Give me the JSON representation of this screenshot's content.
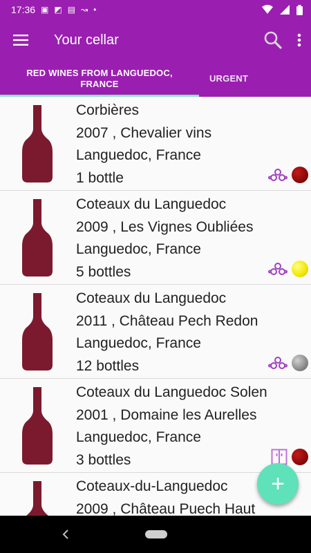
{
  "status_bar": {
    "time": "17:36"
  },
  "app_bar": {
    "title": "Your cellar",
    "menu_icon": "hamburger-icon",
    "search_icon": "search-icon",
    "more_icon": "more-vert-icon"
  },
  "tabs": [
    {
      "label_line1": "RED WINES FROM LANGUEDOC,",
      "label_line2": "FRANCE",
      "active": true
    },
    {
      "label_line1": "URGENT",
      "label_line2": "",
      "active": false
    }
  ],
  "colors": {
    "primary": "#9a1fb0",
    "accent": "#5fe1b9",
    "bottle": "#7b1a2e"
  },
  "wines": [
    {
      "name": "Corbières",
      "year_producer": "2007 , Chevalier vins",
      "region": "Languedoc, France",
      "count": "1  bottle",
      "storage_icon": "bottles-rack-icon",
      "status_color": "#8b0a0a"
    },
    {
      "name": "Coteaux du Languedoc",
      "year_producer": "2009 , Les Vignes Oubliées",
      "region": "Languedoc, France",
      "count": "5  bottles",
      "storage_icon": "bottles-rack-icon",
      "status_color": "#f2e600"
    },
    {
      "name": "Coteaux du Languedoc",
      "year_producer": "2011 , Château Pech Redon",
      "region": "Languedoc, France",
      "count": "12  bottles",
      "storage_icon": "bottles-rack-icon",
      "status_color": "#8a8a8a"
    },
    {
      "name": "Coteaux du Languedoc Solen",
      "year_producer": "2001 , Domaine les Aurelles",
      "region": "Languedoc, France",
      "count": "3  bottles",
      "storage_icon": "cabinet-icon",
      "status_color": "#8b0a0a"
    },
    {
      "name": "Coteaux-du-Languedoc",
      "year_producer": "2009 , Château Puech Haut",
      "region": "",
      "count": "",
      "storage_icon": "",
      "status_color": ""
    }
  ],
  "fab": {
    "label": "+",
    "icon": "add-icon"
  }
}
